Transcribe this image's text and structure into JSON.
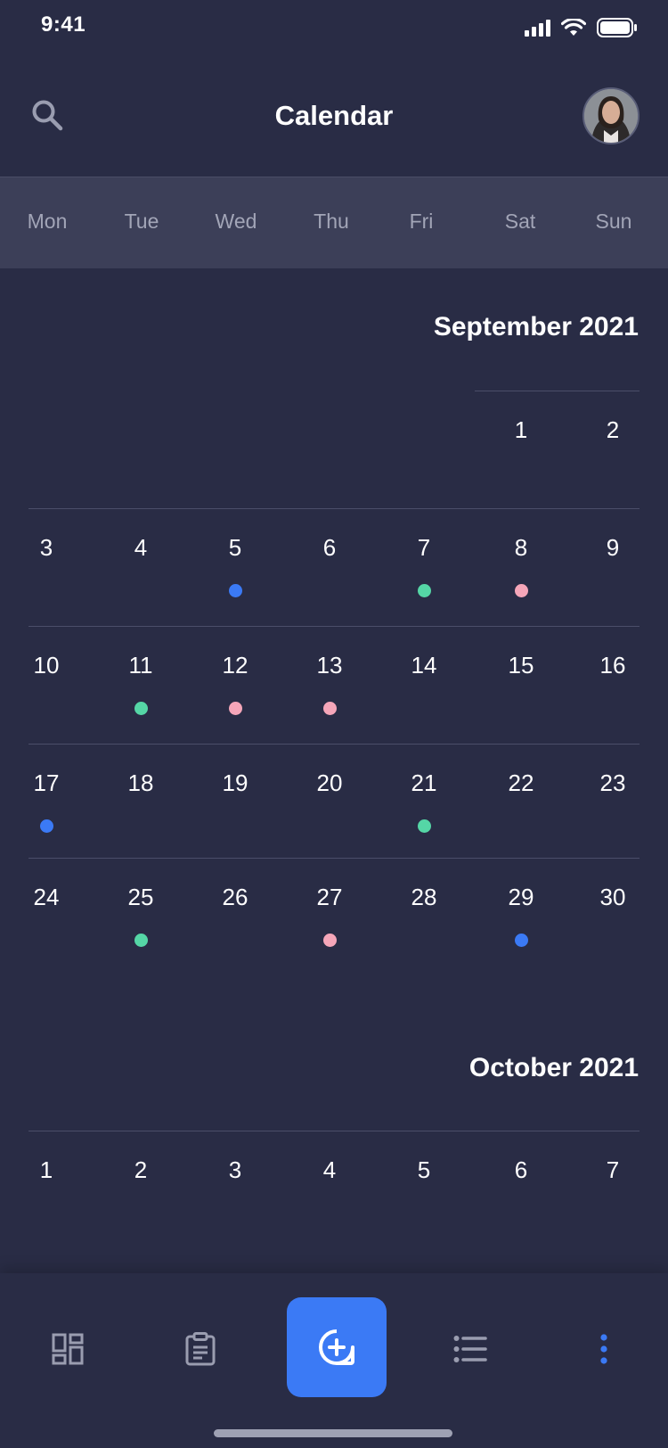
{
  "status_bar": {
    "time": "9:41"
  },
  "header": {
    "title": "Calendar",
    "search_icon": "search-icon",
    "avatar_icon": "user-avatar"
  },
  "weekdays": [
    "Mon",
    "Tue",
    "Wed",
    "Thu",
    "Fri",
    "Sat",
    "Sun"
  ],
  "event_colors": {
    "blue": "#3b7af5",
    "green": "#55d6a6",
    "pink": "#f5a6b9"
  },
  "months": [
    {
      "title": "September 2021",
      "weeks": [
        [
          {
            "day": ""
          },
          {
            "day": ""
          },
          {
            "day": ""
          },
          {
            "day": ""
          },
          {
            "day": ""
          },
          {
            "day": "1"
          },
          {
            "day": "2"
          }
        ],
        [
          {
            "day": "3"
          },
          {
            "day": "4"
          },
          {
            "day": "5",
            "dot": "blue"
          },
          {
            "day": "6"
          },
          {
            "day": "7",
            "dot": "green"
          },
          {
            "day": "8",
            "dot": "pink"
          },
          {
            "day": "9"
          }
        ],
        [
          {
            "day": "10"
          },
          {
            "day": "11",
            "dot": "green"
          },
          {
            "day": "12",
            "dot": "pink"
          },
          {
            "day": "13",
            "dot": "pink"
          },
          {
            "day": "14"
          },
          {
            "day": "15"
          },
          {
            "day": "16"
          }
        ],
        [
          {
            "day": "17",
            "dot": "blue"
          },
          {
            "day": "18"
          },
          {
            "day": "19"
          },
          {
            "day": "20"
          },
          {
            "day": "21",
            "dot": "green"
          },
          {
            "day": "22"
          },
          {
            "day": "23"
          }
        ],
        [
          {
            "day": "24"
          },
          {
            "day": "25",
            "dot": "green"
          },
          {
            "day": "26"
          },
          {
            "day": "27",
            "dot": "pink"
          },
          {
            "day": "28"
          },
          {
            "day": "29",
            "dot": "blue"
          },
          {
            "day": "30"
          }
        ]
      ]
    },
    {
      "title": "October 2021",
      "weeks": [
        [
          {
            "day": "1"
          },
          {
            "day": "2"
          },
          {
            "day": "3"
          },
          {
            "day": "4"
          },
          {
            "day": "5"
          },
          {
            "day": "6"
          },
          {
            "day": "7"
          }
        ]
      ]
    }
  ],
  "bottom_nav": {
    "items": [
      {
        "name": "dashboard",
        "icon": "dashboard-grid-icon"
      },
      {
        "name": "clipboard",
        "icon": "clipboard-icon"
      },
      {
        "name": "add-event",
        "icon": "add-event-icon"
      },
      {
        "name": "list",
        "icon": "list-icon"
      },
      {
        "name": "more",
        "icon": "more-vertical-icon"
      }
    ],
    "fab_color": "#3b7af5"
  }
}
